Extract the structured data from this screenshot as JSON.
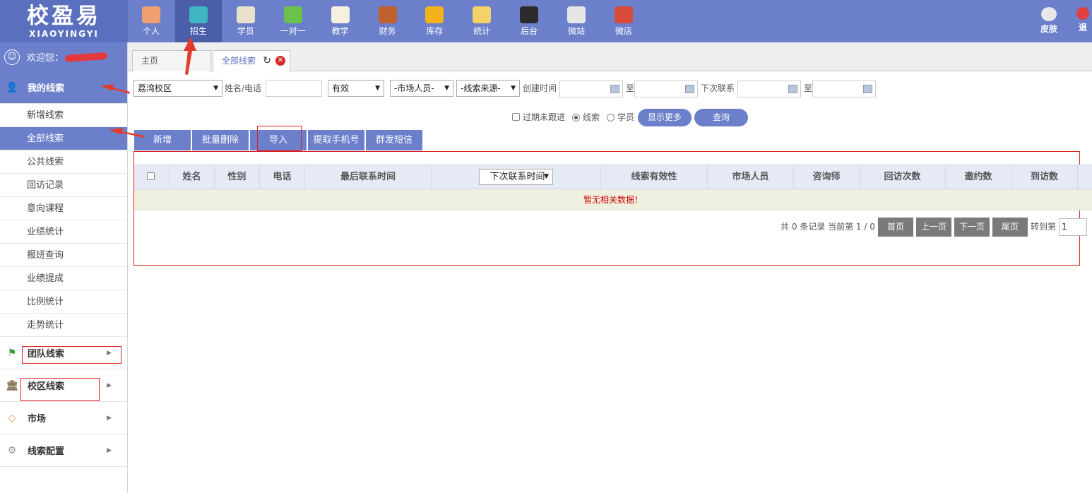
{
  "logo": {
    "cn": "校盈易",
    "en": "XIAOYINGYI"
  },
  "nav": [
    {
      "label": "个人",
      "icon": "person-icon",
      "color": "#f0a070"
    },
    {
      "label": "招生",
      "icon": "magnifier-icon",
      "color": "#3fb6c4",
      "active": true
    },
    {
      "label": "学员",
      "icon": "student-card-icon",
      "color": "#e8e2cc"
    },
    {
      "label": "一对一",
      "icon": "chat-bubble-icon",
      "color": "#6cc14a"
    },
    {
      "label": "教学",
      "icon": "pen-paper-icon",
      "color": "#f5f0e0"
    },
    {
      "label": "财务",
      "icon": "briefcase-icon",
      "color": "#c0602a"
    },
    {
      "label": "库存",
      "icon": "pie-coin-icon",
      "color": "#f2b21c"
    },
    {
      "label": "统计",
      "icon": "bar-chart-icon",
      "color": "#f4d26a"
    },
    {
      "label": "后台",
      "icon": "monitor-icon",
      "color": "#2b2b2b"
    },
    {
      "label": "微站",
      "icon": "webpage-icon",
      "color": "#e6e6e6"
    },
    {
      "label": "微店",
      "icon": "shop-icon",
      "color": "#d94a3a"
    }
  ],
  "topRight": {
    "skin": "皮肤",
    "logout": "退"
  },
  "sidebar": {
    "welcome": "欢迎您：",
    "myLeads": "我的线索",
    "items": [
      "新增线索",
      "全部线索",
      "公共线索",
      "回访记录",
      "意向课程",
      "业绩统计",
      "报班查询",
      "业绩提成",
      "比例统计",
      "走势统计"
    ],
    "sections": [
      {
        "label": "团队线索",
        "icon": "flag-icon"
      },
      {
        "label": "校区线索",
        "icon": "building-icon"
      },
      {
        "label": "市场",
        "icon": "tag-icon"
      },
      {
        "label": "线索配置",
        "icon": "gear-icon"
      }
    ]
  },
  "tabs": {
    "home": "主页",
    "current": "全部线索"
  },
  "filters": {
    "campus": "荔湾校区",
    "nameLabel": "姓名/电话",
    "validity": "有效",
    "marketer": "-市场人员-",
    "source": "-线索来源-",
    "createdLabel": "创建时间",
    "toLabel": "至",
    "nextLabel": "下次联系",
    "toLabel2": "至"
  },
  "options": {
    "overdue": "过期未跟进",
    "leads": "线索",
    "students": "学员",
    "showMore": "显示更多",
    "query": "查询"
  },
  "actions": [
    "新增",
    "批量删除",
    "导入",
    "提取手机号",
    "群发短信"
  ],
  "table": {
    "headers": [
      "姓名",
      "性别",
      "电话",
      "最后联系时间",
      "下次联系时间",
      "线索有效性",
      "市场人员",
      "咨询师",
      "回访次数",
      "邀约数",
      "到访数"
    ],
    "empty": "暂无相关数据！"
  },
  "pager": {
    "summary": "共 0 条记录 当前第 1 / 0",
    "first": "首页",
    "prev": "上一页",
    "next": "下一页",
    "last": "尾页",
    "goto": "转到第",
    "page": "1"
  }
}
